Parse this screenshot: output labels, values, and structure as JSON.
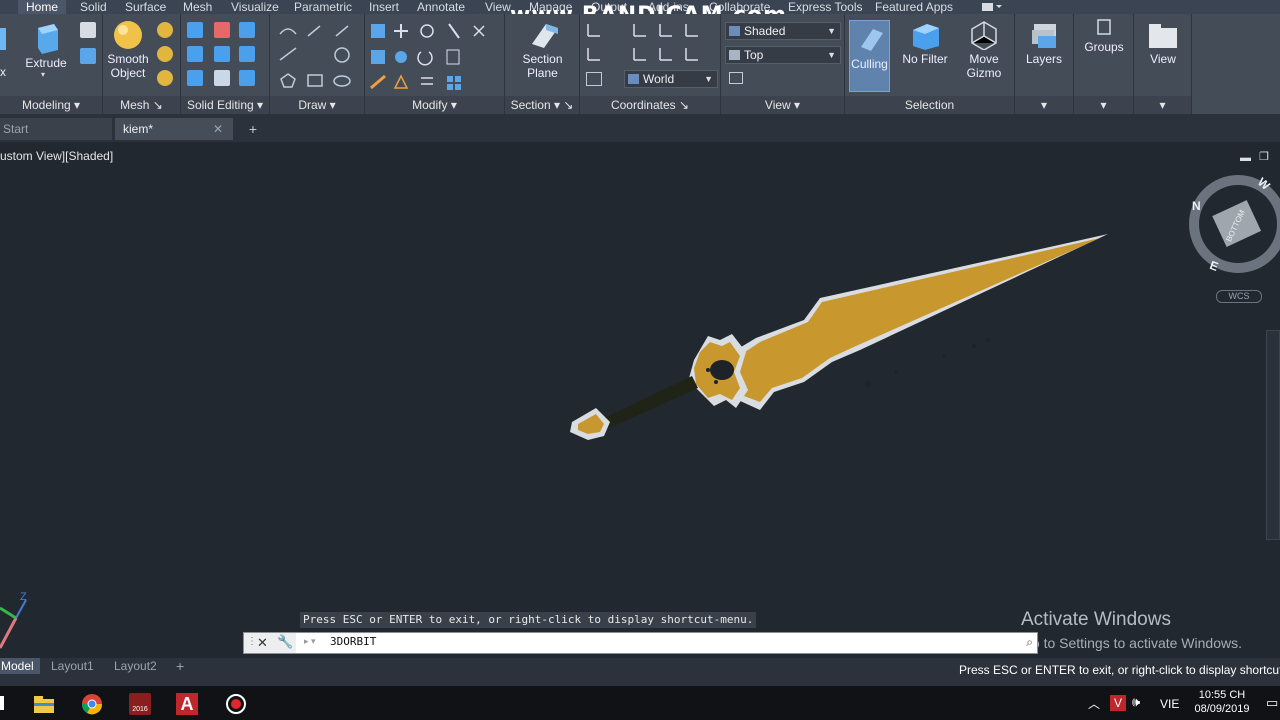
{
  "ribbon_tabs": [
    {
      "label": "Home",
      "active": true
    },
    {
      "label": "Solid"
    },
    {
      "label": "Surface"
    },
    {
      "label": "Mesh"
    },
    {
      "label": "Visualize"
    },
    {
      "label": "Parametric"
    },
    {
      "label": "Insert"
    },
    {
      "label": "Annotate"
    },
    {
      "label": "View"
    },
    {
      "label": "Manage"
    },
    {
      "label": "Output"
    },
    {
      "label": "Add-ins"
    },
    {
      "label": "Collaborate"
    },
    {
      "label": "Express Tools"
    },
    {
      "label": "Featured Apps"
    }
  ],
  "watermark": "www.BANDICAM.com",
  "ribbon": {
    "tools": {
      "extrude": "Extrude",
      "smooth_object_1": "Smooth",
      "smooth_object_2": "Object",
      "section_plane_1": "Section",
      "section_plane_2": "Plane",
      "culling": "Culling",
      "no_filter": "No Filter",
      "move_gizmo_1": "Move",
      "move_gizmo_2": "Gizmo",
      "layers": "Layers",
      "groups": "Groups",
      "view": "View"
    },
    "dropdowns": {
      "visual_style": "Shaded",
      "view_direction": "Top",
      "ucs": "World"
    },
    "panels": {
      "modeling": "Modeling",
      "mesh": "Mesh",
      "solid_editing": "Solid Editing",
      "draw": "Draw",
      "modify": "Modify",
      "section": "Section",
      "coordinates": "Coordinates",
      "view": "View",
      "selection": "Selection"
    }
  },
  "file_tabs": {
    "start": "Start",
    "current": "kiem*"
  },
  "viewport": {
    "label": "ustom View][Shaded]",
    "viewcube_face": "BOTTOM",
    "compass_n": "N",
    "compass_e": "E",
    "compass_w": "W",
    "wcs": "WCS",
    "axis_z": "Z"
  },
  "activate_windows": {
    "title": "Activate Windows",
    "subtitle": "Go to Settings to activate Windows."
  },
  "command": {
    "hint": "Press ESC or ENTER to exit, or right-click to display shortcut-menu.",
    "input": "3DORBIT"
  },
  "layout_tabs": {
    "model": "Model",
    "layout1": "Layout1",
    "layout2": "Layout2"
  },
  "status_message": "Press ESC or ENTER to exit, or right-click to display shortcut-m",
  "taskbar": {
    "language": "VIE",
    "time": "10:55 CH",
    "date": "08/09/2019",
    "app_badge": "2016"
  },
  "colors": {
    "ribbon": "#444c58",
    "viewport": "#212830",
    "blade_gold": "#c8982e",
    "blade_edge": "#d9dde2",
    "handle": "#1f2416"
  }
}
